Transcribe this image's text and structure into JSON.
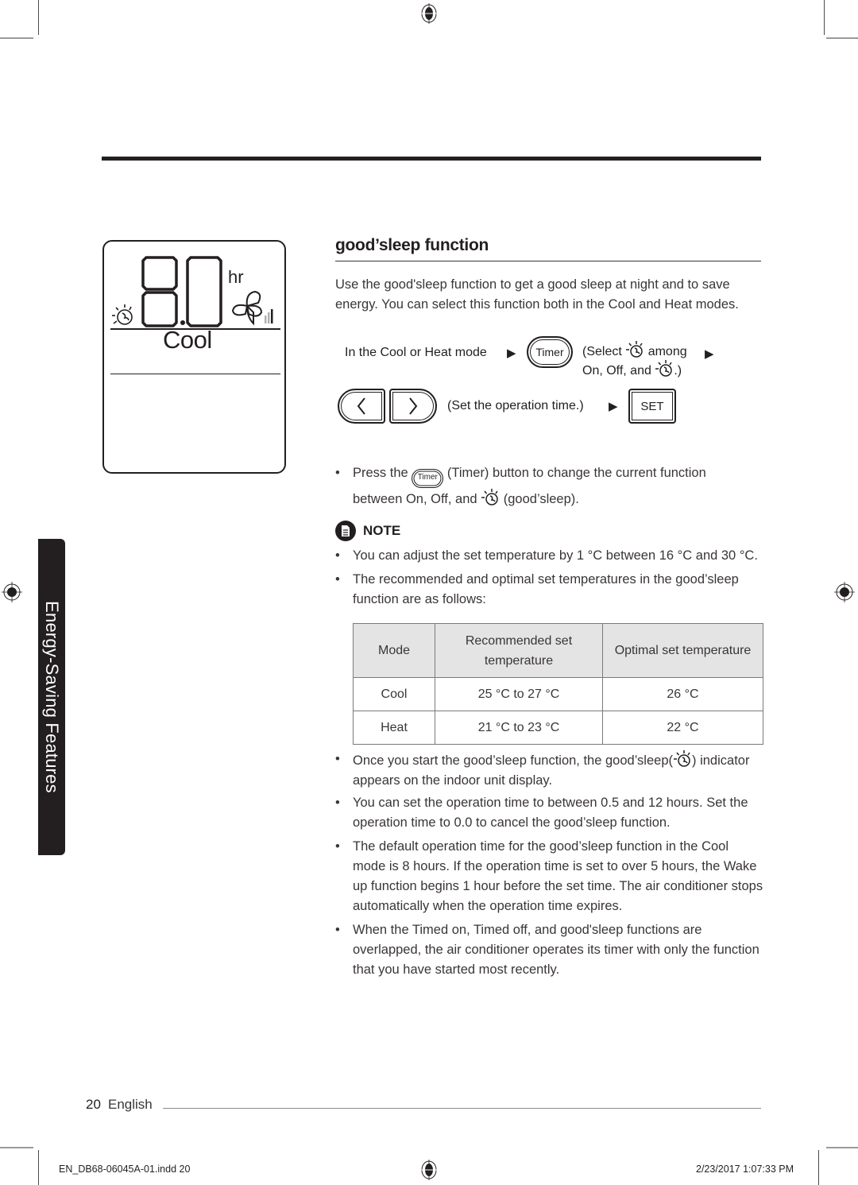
{
  "side_tab": {
    "label": "Energy-Saving Features"
  },
  "display_illustration": {
    "digits": "8.0",
    "unit": "hr",
    "mode": "Cool",
    "icons": [
      "good-sleep-icon",
      "fan-icon",
      "fan-speed-bars-icon"
    ]
  },
  "section": {
    "title": "good’sleep function",
    "intro": "Use the good'sleep function to get a good sleep at night and to save energy. You can select this function both in the Cool and Heat modes."
  },
  "steps": {
    "row1": {
      "condition": "In the Cool or Heat mode",
      "timer_button": "Timer",
      "select_part1": "(Select",
      "select_part2": "among",
      "select_part3": "On, Off, and",
      "select_part4": ".)"
    },
    "row2": {
      "left_button": "<",
      "right_button": ">",
      "instruction": "(Set the operation time.)",
      "set_button": "SET"
    }
  },
  "press_bullet": {
    "part1": "Press the",
    "timer_label": "Timer",
    "part2": "(Timer) button to change the current function",
    "part3": "between On, Off, and",
    "part4": "(good’sleep)."
  },
  "note": {
    "label": "NOTE",
    "bullets": [
      "You can adjust the set temperature by 1 °C between 16 °C and 30 °C.",
      "The recommended and optimal set temperatures in the good’sleep function are as follows:"
    ]
  },
  "table": {
    "headers": [
      "Mode",
      "Recommended set temperature",
      "Optimal set temperature"
    ],
    "rows": [
      [
        "Cool",
        "25 °C to 27 °C",
        "26 °C"
      ],
      [
        "Heat",
        "21 °C to 23 °C",
        "22 °C"
      ]
    ]
  },
  "more_bullets": {
    "indicator_part1": "Once you start the good’sleep function, the good’sleep(",
    "indicator_part2": ") indicator appears on the indoor unit display.",
    "items": [
      "You can set the operation time to between 0.5 and 12 hours. Set the operation time to 0.0 to cancel the good’sleep function.",
      "The default operation time for the good’sleep function in the Cool mode is 8 hours. If the operation time is set to over 5 hours, the Wake up function begins 1 hour before the set time. The air conditioner stops automatically when the operation time expires.",
      "When the Timed on, Timed off, and good'sleep functions are overlapped, the air conditioner operates its timer with only the function that you have started most recently."
    ]
  },
  "footer": {
    "page_number": "20",
    "language": "English",
    "slug_file": "EN_DB68-06045A-01.indd   20",
    "slug_date": "2/23/2017   1:07:33 PM"
  },
  "colors": {
    "ink": "#231f20",
    "body_text": "#3a3536",
    "table_header_bg": "#e4e4e4"
  }
}
